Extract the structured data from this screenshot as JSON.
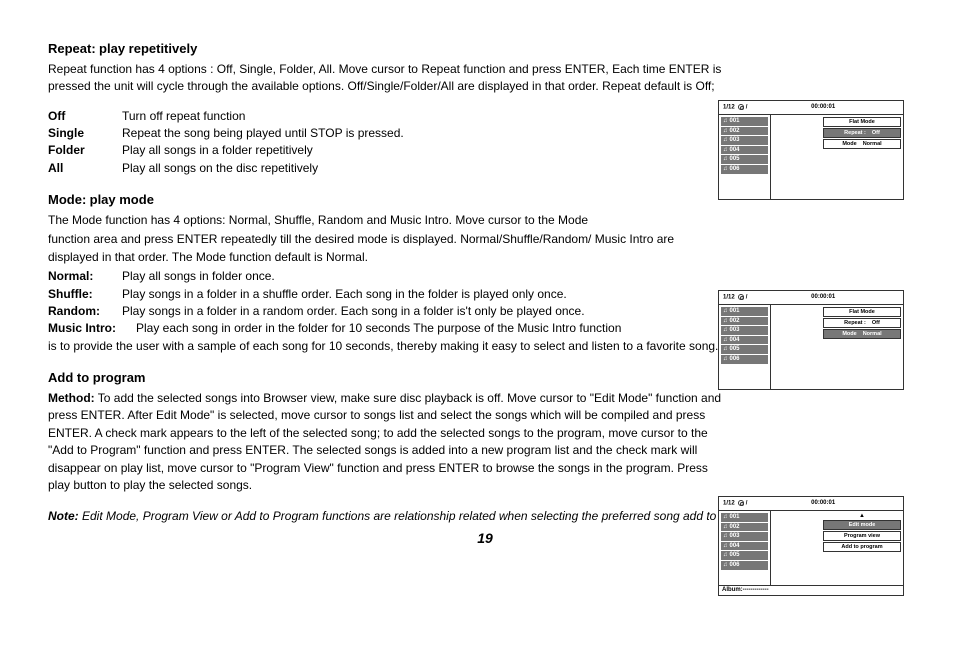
{
  "repeat": {
    "heading_bold": "Repeat:",
    "heading_sub": "play repetitively",
    "p1": "Repeat function has 4 options : Off, Single, Folder, All. Move cursor to Repeat function and press ENTER, Each time ENTER is pressed the unit will cycle through the available options. Off/Single/Folder/All are displayed in that order. Repeat default is Off;",
    "rows": {
      "off_t": "Off",
      "off_d": "Turn off repeat function",
      "single_t": "Single",
      "single_d": "Repeat the song being played until STOP is pressed.",
      "folder_t": "Folder",
      "folder_d": "Play all songs in a folder repetitively",
      "all_t": "All",
      "all_d": "Play all songs on the disc repetitively"
    }
  },
  "mode": {
    "heading_bold": "Mode:",
    "heading_sub": "play mode",
    "p1a": "The Mode function has 4 options: Normal, Shuffle, Random and Music Intro. Move cursor to the Mode",
    "p1b": " function area and press ENTER repeatedly till the desired mode is displayed. Normal/Shuffle/Random/ Music Intro are displayed in that order. The Mode function default is Normal.",
    "rows": {
      "normal_t": "Normal:",
      "normal_d": "Play all songs in folder once.",
      "shuffle_t": "Shuffle:",
      "shuffle_d": "Play songs in a folder in a shuffle order. Each song in the folder is played only once.",
      "random_t": "Random:",
      "random_d": "Play songs in a folder in a random order. Each song in a folder is't only be played once.",
      "intro_t": "Music Intro:",
      "intro_d": "Play each song in order in the folder for 10 seconds The purpose of the Music Intro function"
    },
    "p_tail": "is to provide the user with a sample of each song for 10 seconds, thereby making it easy to select and listen to a favorite song."
  },
  "add": {
    "heading": "Add to program",
    "method_label": "Method:",
    "method_text": " To add the selected songs into Browser view, make sure disc playback is off. Move cursor to \"Edit Mode\" function and press ENTER. After Edit Mode\" is selected, move cursor to songs list and select the songs which will be compiled and press ENTER. A check mark appears to the left of the selected song; to add the selected songs to the program, move cursor to the \"Add to Program\" function and press ENTER. The selected songs is added into a new program list and the check mark will disappear on play list, move cursor to \"Program View\" function and press ENTER to browse the songs in the program. Press play button to play the selected songs.",
    "note_label": "Note:",
    "note_text": " Edit Mode, Program View or Add to Program functions are relationship related when selecting the preferred song add to the songs list."
  },
  "page_number": "19",
  "shots": {
    "time": "00:00:01",
    "frac": "1/12",
    "slash": "/",
    "songs": [
      "001",
      "002",
      "003",
      "004",
      "005",
      "006"
    ],
    "info_flat": "Flat Mode",
    "info_repeat_l": "Repeat :",
    "info_repeat_v": "Off",
    "info_mode_l": "Mode",
    "info_mode_v": "Normal",
    "bot": {
      "edit": "Edit mode",
      "program": "Program view",
      "addto": "Add to program",
      "album": "Album:-------------"
    }
  }
}
